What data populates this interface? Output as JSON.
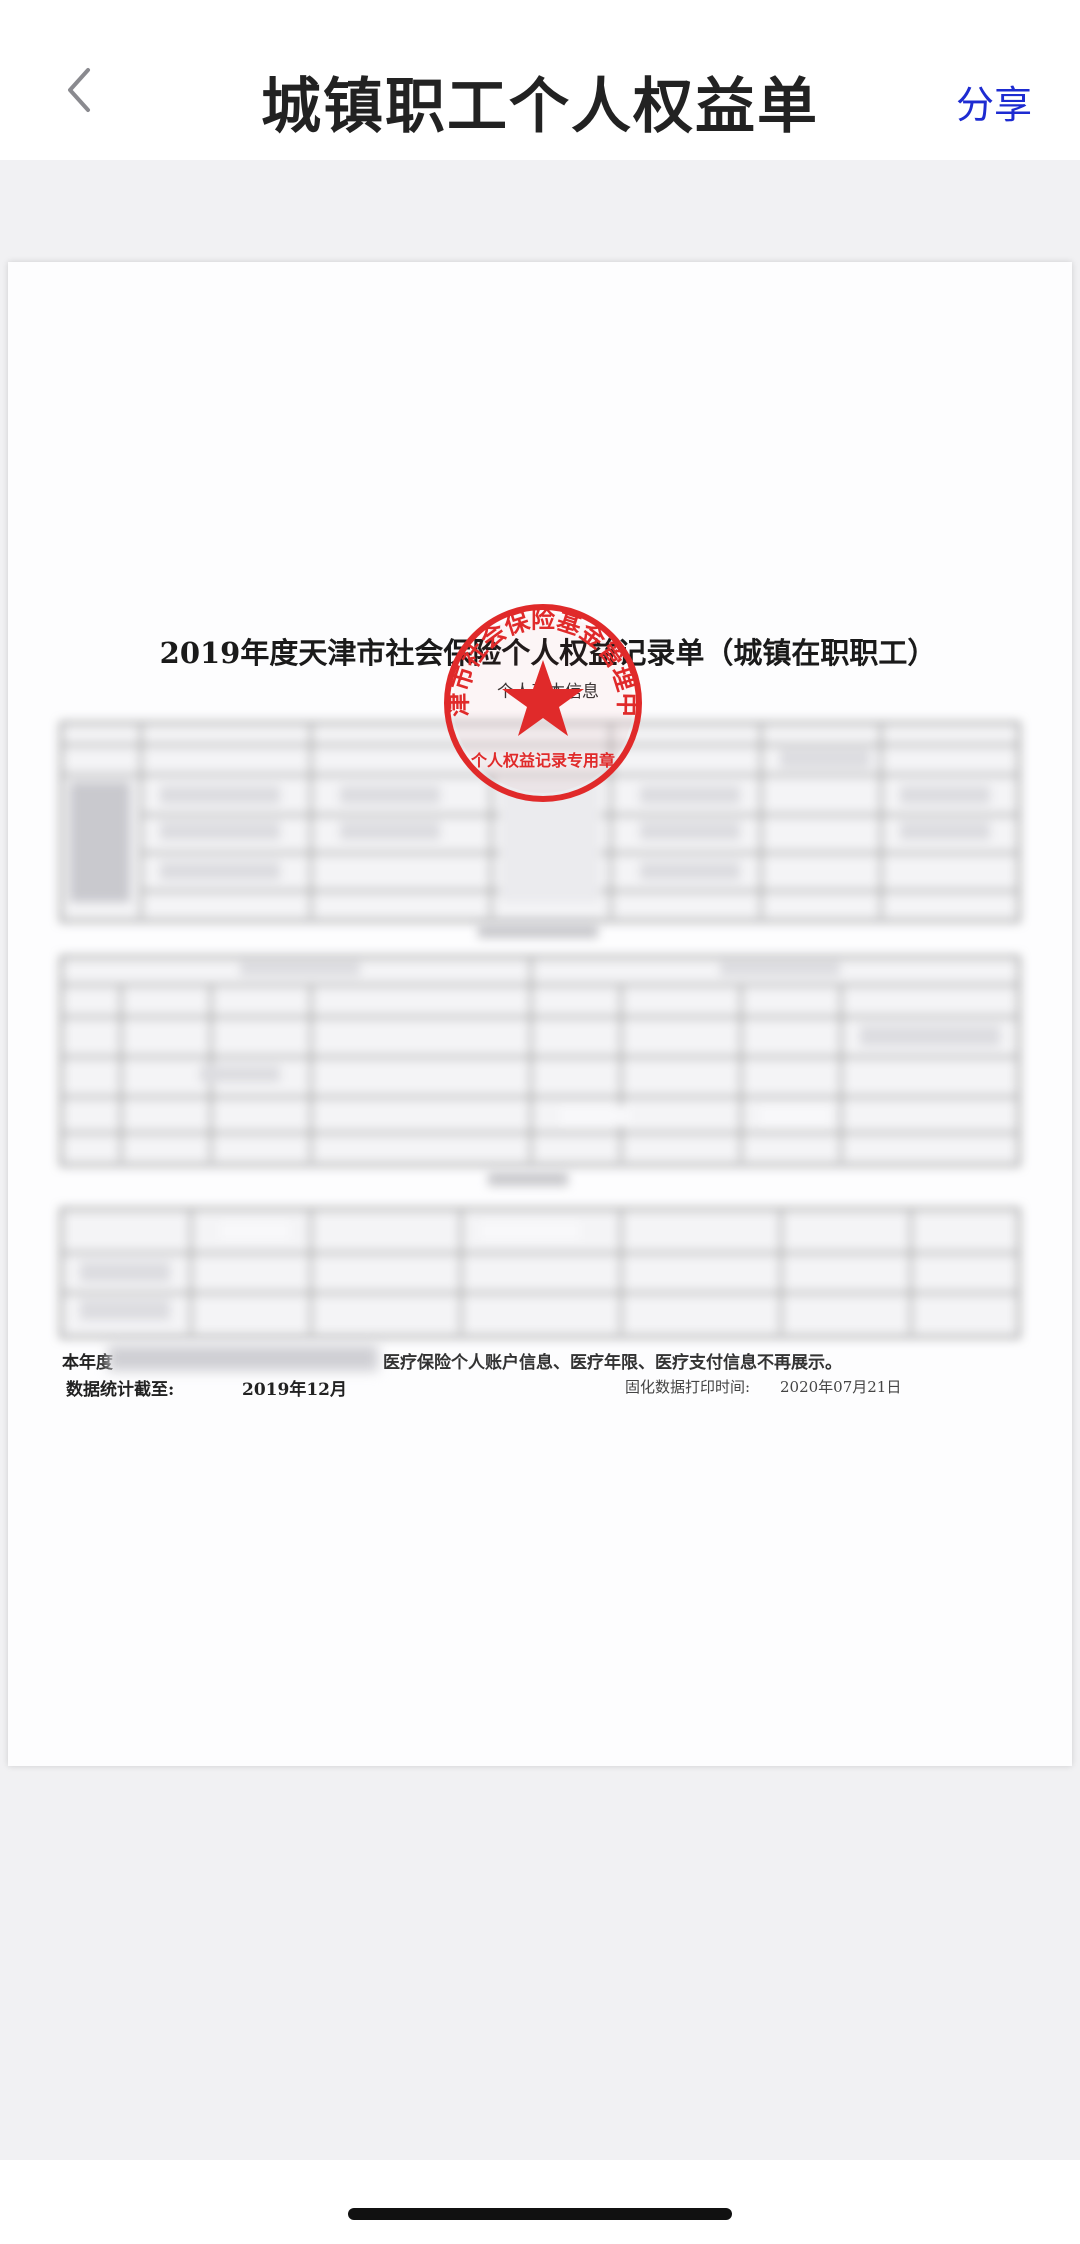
{
  "nav": {
    "title": "城镇职工个人权益单",
    "share_label": "分享",
    "back_icon": "chevron-left-icon"
  },
  "document": {
    "title": "2019年度天津市社会保险个人权益记录单（城镇在职职工）",
    "subtitle": "个人基本信息",
    "seal_text": "天津市社会保险基金管理中心",
    "seal_bottom_text": "个人权益记录专用章",
    "note_prefix": "本年度",
    "note_visible": "医疗保险个人账户信息、医疗年限、医疗支付信息不再展示。",
    "stat_label": "数据统计截至:",
    "stat_value": "2019年12月",
    "print_label": "固化数据打印时间:",
    "print_value": "2020年07月21日"
  },
  "colors": {
    "accent": "#1d2bd1",
    "seal_red": "#e02a2a"
  }
}
